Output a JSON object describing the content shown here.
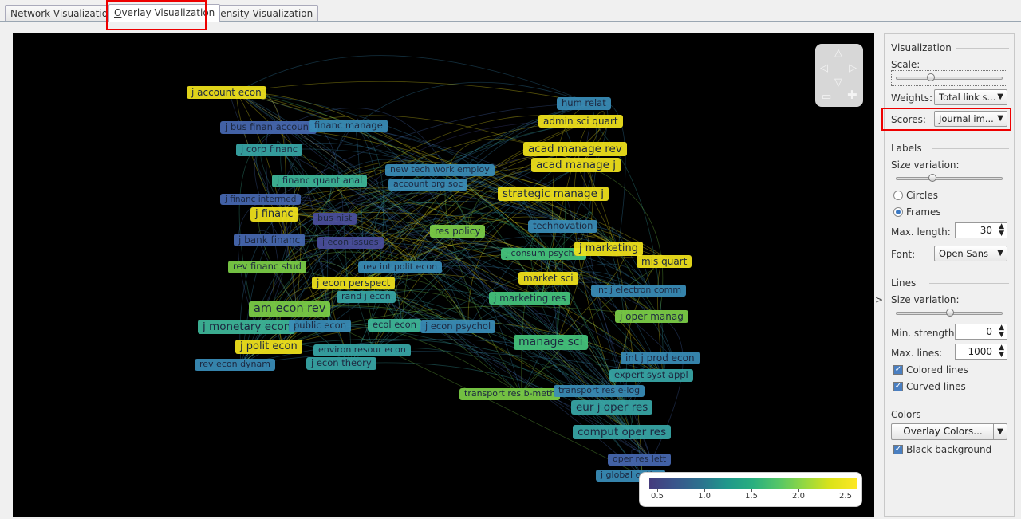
{
  "tabs": {
    "network": {
      "ul": "N",
      "rest": "etwork Visualization"
    },
    "overlay": {
      "ul": "O",
      "rest": "verlay Visualization"
    },
    "density": {
      "ul": "D",
      "rest": "ensity Visualization"
    }
  },
  "colors": {
    "c05": "#4b4f9e",
    "c08": "#4769b2",
    "c10": "#3a8db8",
    "c12": "#38a7a7",
    "c14": "#3fb89a",
    "c17": "#45c57d",
    "c20": "#7ccf48",
    "c23": "#b6dd2b",
    "c26": "#f2e41d"
  },
  "map": {
    "labels": [
      {
        "text": "j account econ",
        "color": "c26"
      },
      {
        "text": "j bus finan account",
        "color": "c08"
      },
      {
        "text": "financ manage",
        "color": "c10"
      },
      {
        "text": "j corp financ",
        "color": "c12"
      },
      {
        "text": "j financ quant anal",
        "color": "c14"
      },
      {
        "text": "j financ intermed",
        "color": "c08"
      },
      {
        "text": "j financ",
        "color": "c26"
      },
      {
        "text": "bus hist",
        "color": "c05"
      },
      {
        "text": "j bank financ",
        "color": "c08"
      },
      {
        "text": "j econ issues",
        "color": "c05"
      },
      {
        "text": "rev financ stud",
        "color": "c20"
      },
      {
        "text": "rev int polit econ",
        "color": "c10"
      },
      {
        "text": "j econ perspect",
        "color": "c26"
      },
      {
        "text": "rand j econ",
        "color": "c12"
      },
      {
        "text": "am econ rev",
        "color": "c20"
      },
      {
        "text": "j monetary econ",
        "color": "c14"
      },
      {
        "text": "public econ",
        "color": "c10"
      },
      {
        "text": "ecol econ",
        "color": "c14"
      },
      {
        "text": "j econ psychol",
        "color": "c10"
      },
      {
        "text": "j polit econ",
        "color": "c26"
      },
      {
        "text": "environ resour econ",
        "color": "c12"
      },
      {
        "text": "rev econ dynam",
        "color": "c10"
      },
      {
        "text": "j econ theory",
        "color": "c12"
      },
      {
        "text": "hum relat",
        "color": "c10"
      },
      {
        "text": "admin sci quart",
        "color": "c26"
      },
      {
        "text": "acad manage rev",
        "color": "c26"
      },
      {
        "text": "acad manage j",
        "color": "c26"
      },
      {
        "text": "new tech work employ",
        "color": "c10"
      },
      {
        "text": "account org soc",
        "color": "c10"
      },
      {
        "text": "strategic manage j",
        "color": "c26"
      },
      {
        "text": "res policy",
        "color": "c20"
      },
      {
        "text": "technovation",
        "color": "c10"
      },
      {
        "text": "j consum psychol",
        "color": "c17"
      },
      {
        "text": "j marketing",
        "color": "c26"
      },
      {
        "text": "mis quart",
        "color": "c26"
      },
      {
        "text": "market sci",
        "color": "c26"
      },
      {
        "text": "j marketing res",
        "color": "c17"
      },
      {
        "text": "int j electron comm",
        "color": "c10"
      },
      {
        "text": "j oper manag",
        "color": "c20"
      },
      {
        "text": "manage sci",
        "color": "c17"
      },
      {
        "text": "int j prod econ",
        "color": "c10"
      },
      {
        "text": "expert syst appl",
        "color": "c12"
      },
      {
        "text": "transport res b-meth",
        "color": "c20"
      },
      {
        "text": "transport res e-log",
        "color": "c10"
      },
      {
        "text": "eur j oper res",
        "color": "c12"
      },
      {
        "text": "comput oper res",
        "color": "c12"
      },
      {
        "text": "oper res lett",
        "color": "c08"
      },
      {
        "text": "j global optim",
        "color": "c10"
      }
    ]
  },
  "legend": {
    "ticks": [
      "0.5",
      "1.0",
      "1.5",
      "2.0",
      "2.5"
    ]
  },
  "panel": {
    "visualization": {
      "title": "Visualization",
      "scale_label": "Scale:",
      "weights_label": "Weights:",
      "weights_value": "Total link s...",
      "scores_label": "Scores:",
      "scores_value": "Journal im..."
    },
    "labels": {
      "title": "Labels",
      "size_variation": "Size variation:",
      "circles": "Circles",
      "frames": "Frames",
      "max_length_label": "Max. length:",
      "max_length_value": "30",
      "font_label": "Font:",
      "font_value": "Open Sans"
    },
    "lines": {
      "title": "Lines",
      "size_variation": "Size variation:",
      "min_strength_label": "Min. strength:",
      "min_strength_value": "0",
      "max_lines_label": "Max. lines:",
      "max_lines_value": "1000",
      "colored_lines": "Colored lines",
      "curved_lines": "Curved lines"
    },
    "colors": {
      "title": "Colors",
      "overlay_button": "Overlay Colors...",
      "black_background": "Black background"
    }
  }
}
